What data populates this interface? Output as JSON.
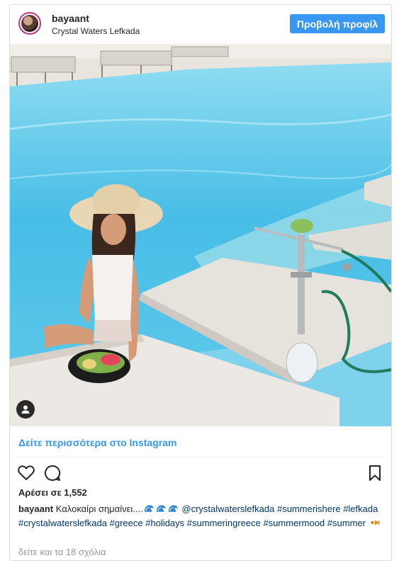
{
  "post": {
    "username": "bayaant",
    "location": "Crystal Waters Lefkada",
    "profile_button": "Προβολή προφίλ"
  },
  "links": {
    "see_more": "Δείτε περισσότερα στο Instagram"
  },
  "stats": {
    "likes": "Αρέσει σε 1,552"
  },
  "caption": {
    "username": "bayaant",
    "text_prefix": "Καλοκαίρι σημαίνει....",
    "mention": "@crystalwaterslefkada",
    "tags": [
      "#summerishere",
      "#lefkada",
      "#crystalwaterslefkada",
      "#greece",
      "#holidays",
      "#summeringreece",
      "#summermood",
      "#summer"
    ]
  },
  "comments": {
    "view_all": "δείτε και τα 18 σχόλια"
  },
  "icons": {
    "like": "heart-icon",
    "comment": "comment-icon",
    "save": "bookmark-icon",
    "tagged_user": "user-tag-icon",
    "wave": "wave-emoji-icon",
    "fish": "tropical-fish-emoji-icon"
  },
  "colors": {
    "accent": "#3897f0",
    "link": "#003569",
    "muted": "#999999",
    "border": "#dbdbdb"
  }
}
